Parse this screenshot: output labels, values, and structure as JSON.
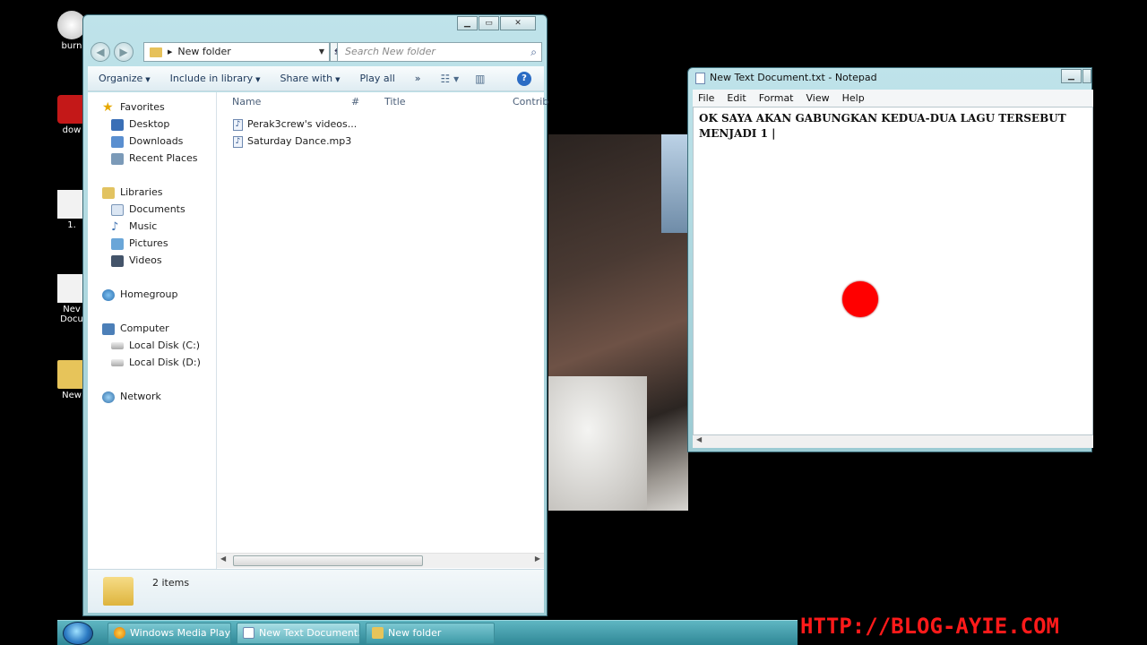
{
  "desktop": {
    "icons": [
      {
        "label": "burn"
      },
      {
        "label": "dow"
      },
      {
        "label": "1."
      },
      {
        "label": "Nev Docu"
      },
      {
        "label": "New"
      }
    ]
  },
  "explorer": {
    "address": "New folder",
    "search_placeholder": "Search New folder",
    "toolbar": {
      "organize": "Organize",
      "include": "Include in library",
      "share": "Share with",
      "play_all": "Play all",
      "more": "»"
    },
    "nav": {
      "favorites": "Favorites",
      "desktop": "Desktop",
      "downloads": "Downloads",
      "recent": "Recent Places",
      "libraries": "Libraries",
      "documents": "Documents",
      "music": "Music",
      "pictures": "Pictures",
      "videos": "Videos",
      "homegroup": "Homegroup",
      "computer": "Computer",
      "disk_c": "Local Disk (C:)",
      "disk_d": "Local Disk (D:)",
      "network": "Network"
    },
    "columns": {
      "name": "Name",
      "number": "#",
      "title": "Title",
      "contrib": "Contrib"
    },
    "files": [
      {
        "name": "Perak3crew's videos..."
      },
      {
        "name": "Saturday Dance.mp3"
      }
    ],
    "item_count": "2 items"
  },
  "notepad": {
    "title": "New Text Document.txt - Notepad",
    "menu": {
      "file": "File",
      "edit": "Edit",
      "format": "Format",
      "view": "View",
      "help": "Help"
    },
    "content": "OK SAYA AKAN GABUNGKAN KEDUA-DUA LAGU TERSEBUT\nMENJADI 1 |"
  },
  "taskbar": {
    "buttons": [
      {
        "label": "Windows Media Player"
      },
      {
        "label": "New Text Document..."
      },
      {
        "label": "New folder"
      }
    ]
  },
  "watermark": "HTTP://BLOG-AYIE.COM",
  "colors": {
    "cursor_dot": "#ff0000",
    "watermark": "#ff1a1a",
    "taskbar": "#3e9aa7"
  }
}
